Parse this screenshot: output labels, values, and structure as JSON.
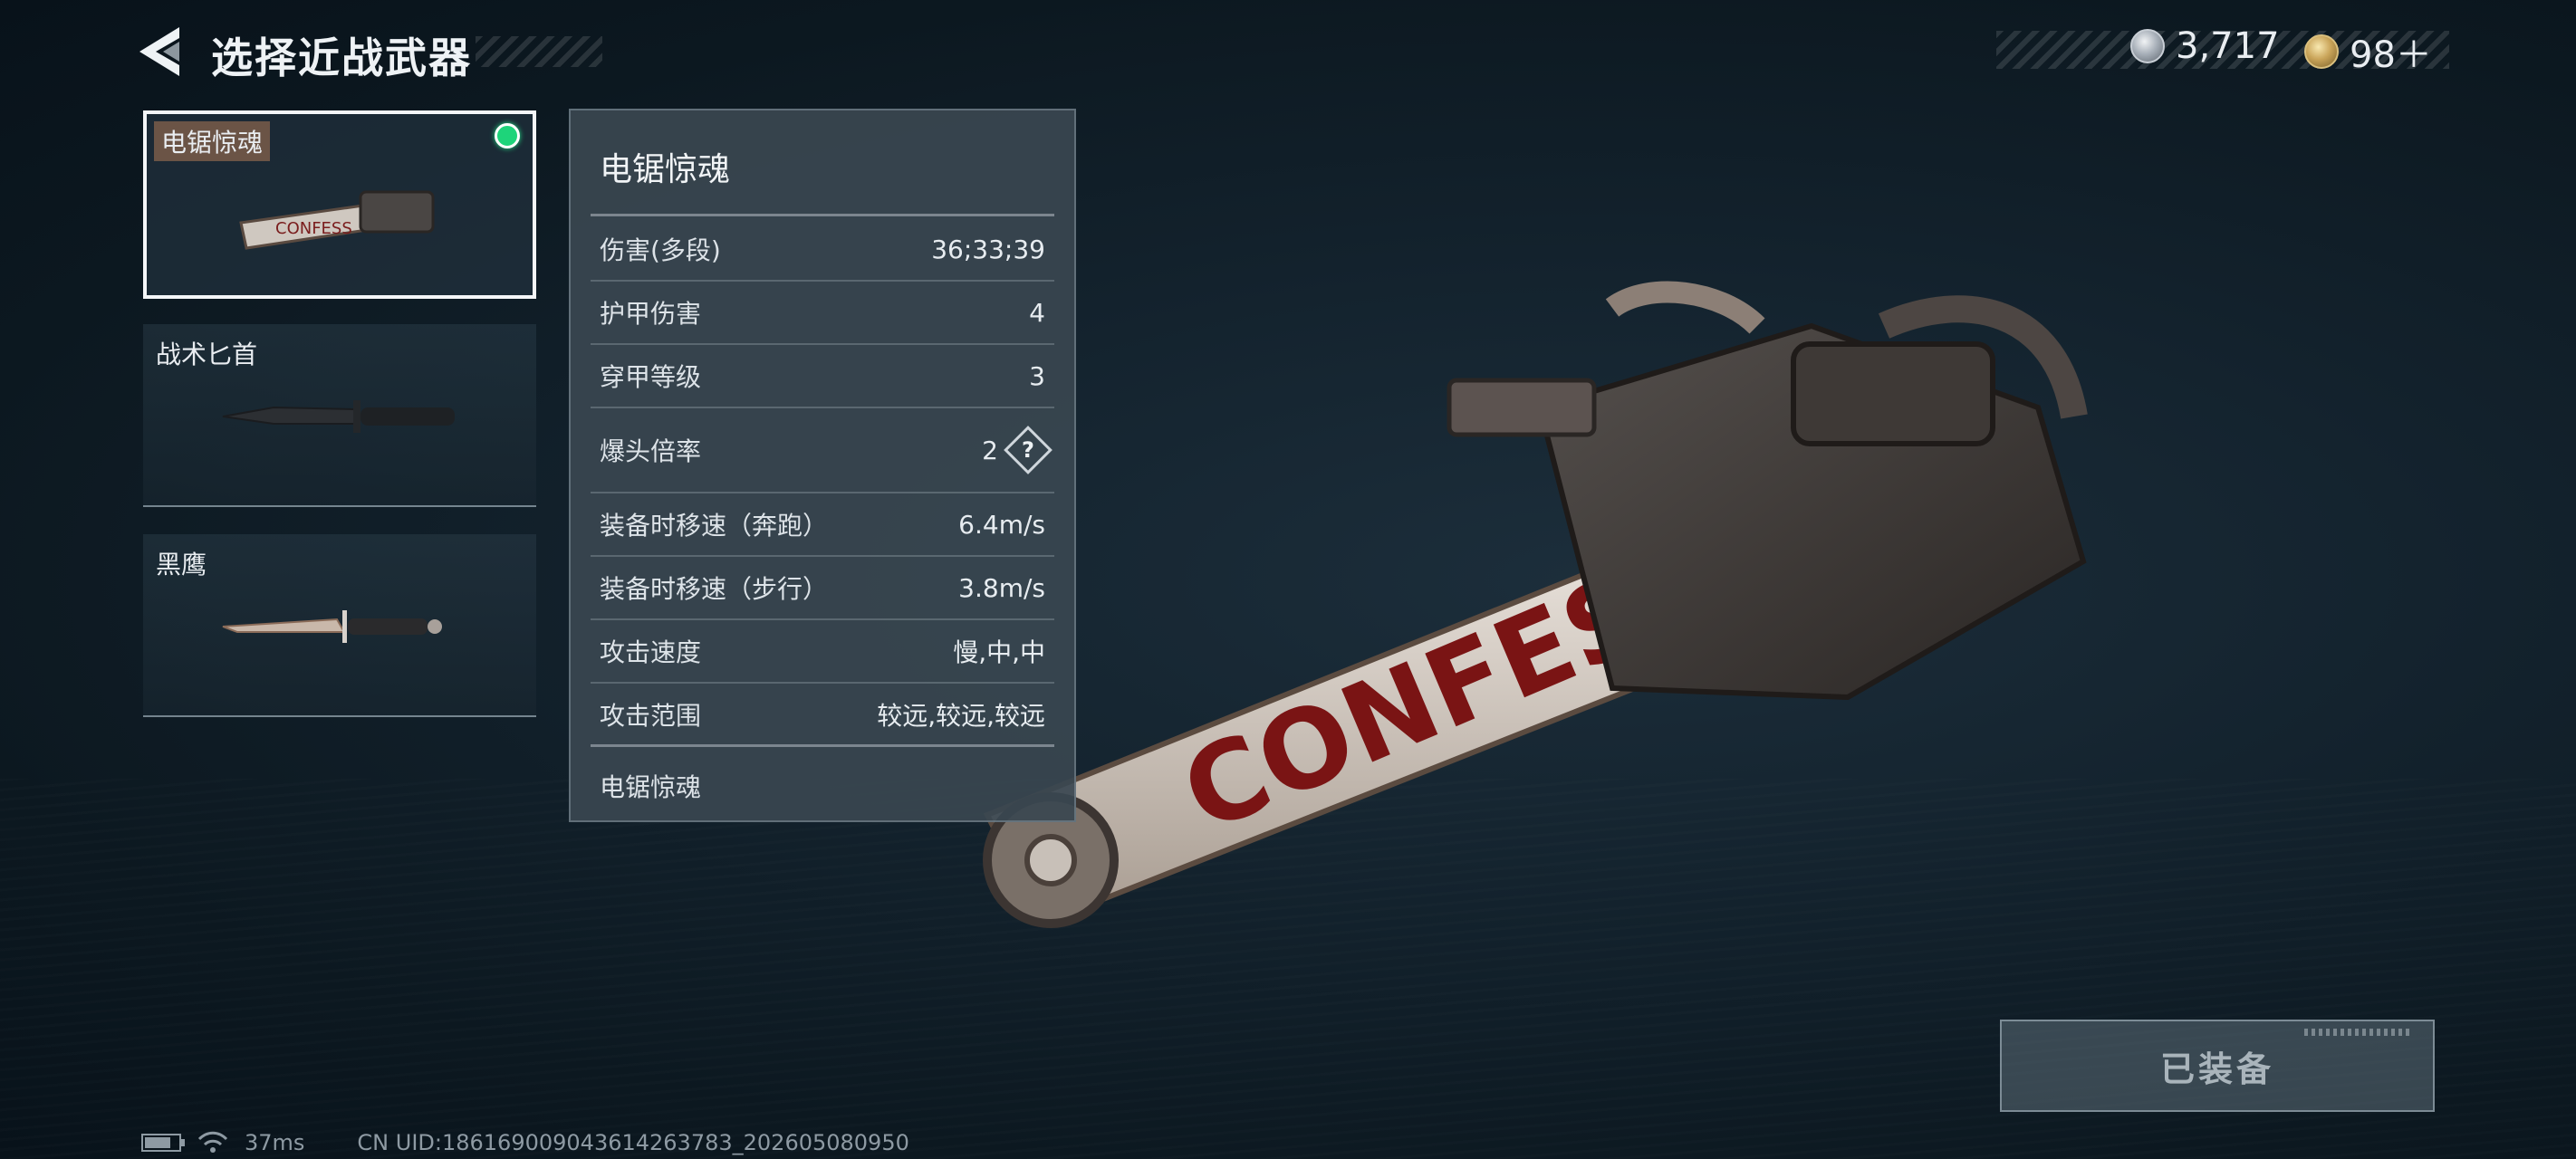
{
  "header": {
    "title": "选择近战武器"
  },
  "currency": [
    {
      "icon": "silver-coin-icon",
      "value": "3,717"
    },
    {
      "icon": "gold-coin-icon",
      "value": "98＋"
    }
  ],
  "weapons": [
    {
      "label": "电锯惊魂",
      "selected": true,
      "equipped": true
    },
    {
      "label": "战术匕首",
      "selected": false,
      "equipped": false
    },
    {
      "label": "黑鹰",
      "selected": false,
      "equipped": false
    }
  ],
  "stats_panel": {
    "title": "电锯惊魂",
    "rows": [
      {
        "label": "伤害(多段)",
        "value": "36;33;39"
      },
      {
        "label": "护甲伤害",
        "value": "4"
      },
      {
        "label": "穿甲等级",
        "value": "3"
      },
      {
        "label": "爆头倍率",
        "value": "2",
        "help": "?"
      },
      {
        "label": "装备时移速（奔跑）",
        "value": "6.4m/s"
      },
      {
        "label": "装备时移速（步行）",
        "value": "3.8m/s"
      },
      {
        "label": "攻击速度",
        "value": "慢,中,中"
      },
      {
        "label": "攻击范围",
        "value": "较远,较远,较远"
      }
    ],
    "footer": "电锯惊魂"
  },
  "equip_button": {
    "label": "已装备",
    "state": "disabled"
  },
  "status_bar": {
    "ping": "37ms",
    "uid": "CN UID:186169009043614263783_202605080950"
  },
  "colors": {
    "background": "#13222d",
    "equipped_indicator": "#1ed47a",
    "panel": "#3a4650"
  }
}
